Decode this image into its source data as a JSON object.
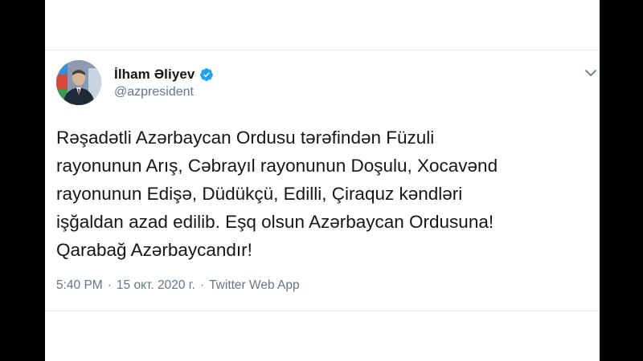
{
  "tweet": {
    "author": {
      "display_name": "İlham Əliyev",
      "handle": "@azpresident",
      "verified": true,
      "avatar_icon": "user-avatar-photo"
    },
    "text": "Rəşadətli Azərbaycan Ordusu tərəfindən Füzuli\nrayonunun Arış, Cəbrayıl rayonunun Doşulu, Xocavənd\nrayonunun Edişə, Düdükçü, Edilli, Çiraquz kəndləri\nişğaldan azad edilib. Eşq olsun Azərbaycan Ordusuna!\nQarabağ Azərbaycandır!",
    "time": "5:40 PM",
    "date": "15 окт. 2020 г.",
    "source": "Twitter Web App",
    "separator": "·",
    "menu_icon": "chevron-down-icon"
  },
  "colors": {
    "text_primary": "#14171a",
    "text_secondary": "#657786",
    "verified_blue": "#1da1f2",
    "divider": "#e6ecf0",
    "background": "#ffffff",
    "letterbox": "#000000"
  }
}
